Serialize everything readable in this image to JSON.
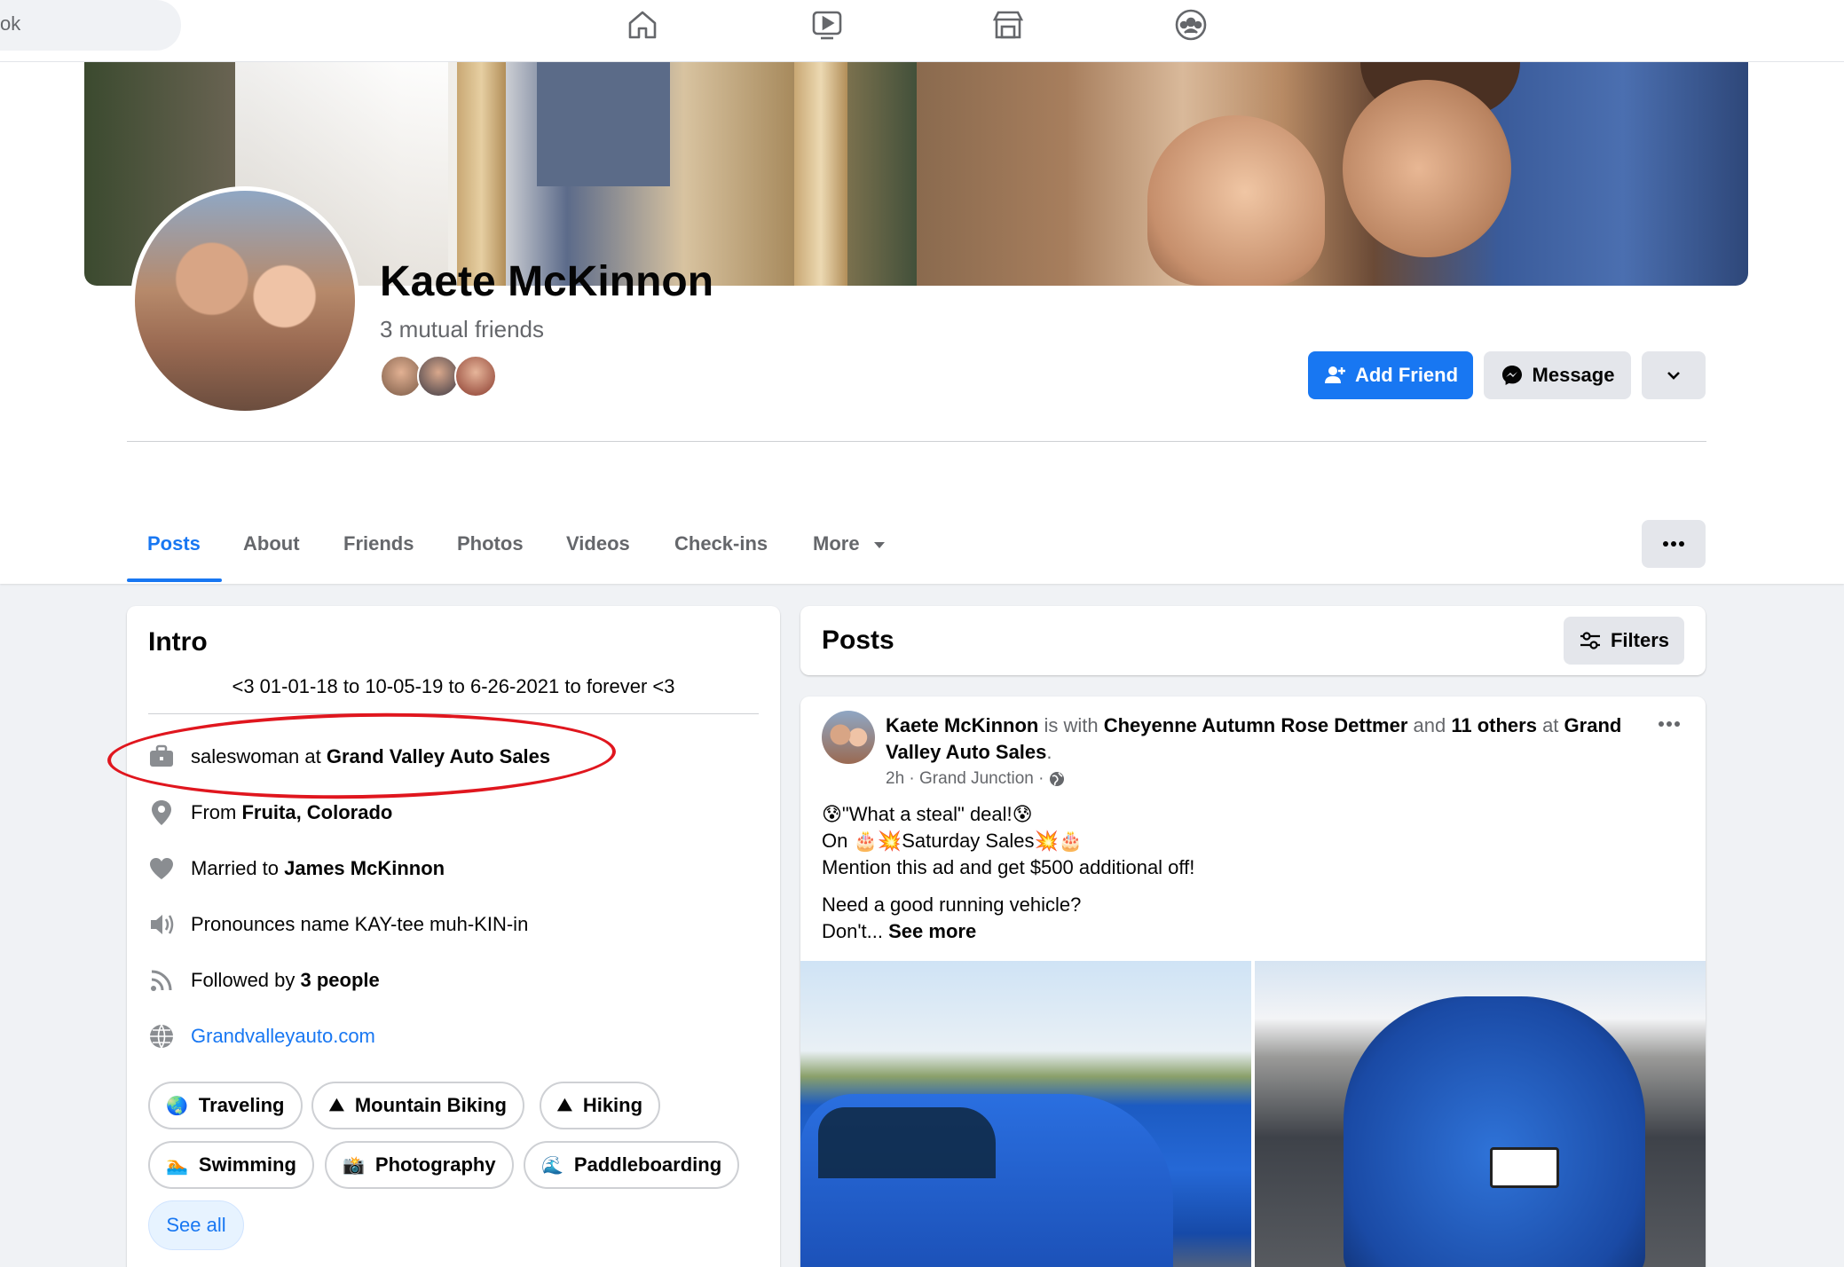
{
  "topbar": {
    "search_fragment": "ok",
    "nav_icons": [
      "home-icon",
      "watch-icon",
      "marketplace-icon",
      "groups-icon"
    ]
  },
  "profile": {
    "name": "Kaete McKinnon",
    "mutual_friends": "3 mutual friends",
    "add_friend_label": "Add Friend",
    "message_label": "Message"
  },
  "tabs": [
    {
      "label": "Posts",
      "active": true
    },
    {
      "label": "About"
    },
    {
      "label": "Friends"
    },
    {
      "label": "Photos"
    },
    {
      "label": "Videos"
    },
    {
      "label": "Check-ins"
    },
    {
      "label": "More"
    }
  ],
  "intro": {
    "title": "Intro",
    "bio": "<3 01-01-18 to 10-05-19 to 6-26-2021 to forever <3",
    "work_prefix": "saleswoman at ",
    "work_place": "Grand Valley Auto Sales",
    "from_prefix": "From ",
    "from_place": "Fruita, Colorado",
    "married_prefix": "Married to ",
    "married_to": "James McKinnon",
    "pronounce": "Pronounces name KAY-tee muh-KIN-in",
    "followed_prefix": "Followed by ",
    "followed_count": "3 people",
    "website": "Grandvalleyauto.com",
    "hobbies": [
      "Traveling",
      "Mountain Biking",
      "Hiking",
      "Swimming",
      "Photography",
      "Paddleboarding"
    ],
    "see_all": "See all"
  },
  "posts_section": {
    "title": "Posts",
    "filters_label": "Filters"
  },
  "post": {
    "author": "Kaete McKinnon",
    "is_with": " is with ",
    "tagged": "Cheyenne Autumn Rose Dettmer",
    "and": " and ",
    "others": "11 others",
    "at": " at ",
    "place": "Grand Valley Auto Sales",
    "period": ".",
    "time": "2h · Grand Junction ·",
    "line1": "😰\"What a steal\" deal!😰",
    "line2": "On 🎂💥Saturday Sales💥🎂",
    "line3": "Mention this ad and get $500 additional off!",
    "line4": "Need a good running vehicle?",
    "line5": "Don't... ",
    "see_more": "See more"
  },
  "colors": {
    "accent": "#1877f2",
    "highlight_oval": "#e0161e"
  }
}
